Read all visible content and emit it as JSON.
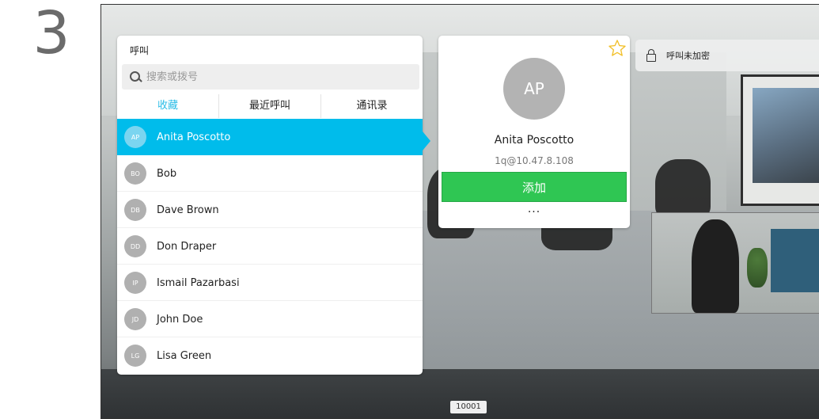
{
  "step": "3",
  "call_panel": {
    "title": "呼叫",
    "search_placeholder": "搜索或拨号",
    "tabs": [
      {
        "label": "收藏",
        "active": true
      },
      {
        "label": "最近呼叫",
        "active": false
      },
      {
        "label": "通讯录",
        "active": false
      }
    ],
    "contacts": [
      {
        "initials": "AP",
        "name": "Anita Poscotto",
        "selected": true
      },
      {
        "initials": "BO",
        "name": "Bob",
        "selected": false
      },
      {
        "initials": "DB",
        "name": "Dave Brown",
        "selected": false
      },
      {
        "initials": "DD",
        "name": "Don Draper",
        "selected": false
      },
      {
        "initials": "IP",
        "name": "Ismail Pazarbasi",
        "selected": false
      },
      {
        "initials": "JD",
        "name": "John Doe",
        "selected": false
      },
      {
        "initials": "LG",
        "name": "Lisa Green",
        "selected": false
      }
    ]
  },
  "contact_card": {
    "initials": "AP",
    "name": "Anita Poscotto",
    "address": "1q@10.47.8.108",
    "add_label": "添加",
    "more_label": "...",
    "star_icon": "star-outline-icon"
  },
  "encryption": {
    "icon": "lock-open-icon",
    "text": "呼叫未加密"
  },
  "call_id": "10001",
  "colors": {
    "accent": "#00bceb",
    "add_button": "#2fc653",
    "star": "#f2c12e"
  }
}
